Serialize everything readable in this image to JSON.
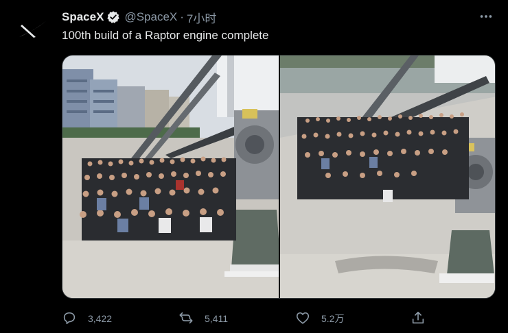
{
  "account": {
    "name": "SpaceX",
    "handle": "@SpaceX",
    "separator": "·",
    "time": "7小时",
    "avatar_icon": "spacex-logo-icon",
    "verified_icon": "verified-badge-icon"
  },
  "tweet": {
    "text": "100th build of a Raptor engine complete"
  },
  "media": {
    "photos": [
      {
        "description_icon": "team-photo-left"
      },
      {
        "description_icon": "team-photo-right"
      }
    ]
  },
  "actions": {
    "reply": {
      "icon": "reply-icon",
      "count": "3,422"
    },
    "retweet": {
      "icon": "retweet-icon",
      "count": "5,411"
    },
    "like": {
      "icon": "like-icon",
      "count": "5.2万"
    },
    "share": {
      "icon": "share-icon"
    }
  },
  "colors": {
    "background": "#000000",
    "text": "#e7e9ea",
    "secondary": "#8b98a5",
    "verified": "#e7e9ea"
  }
}
